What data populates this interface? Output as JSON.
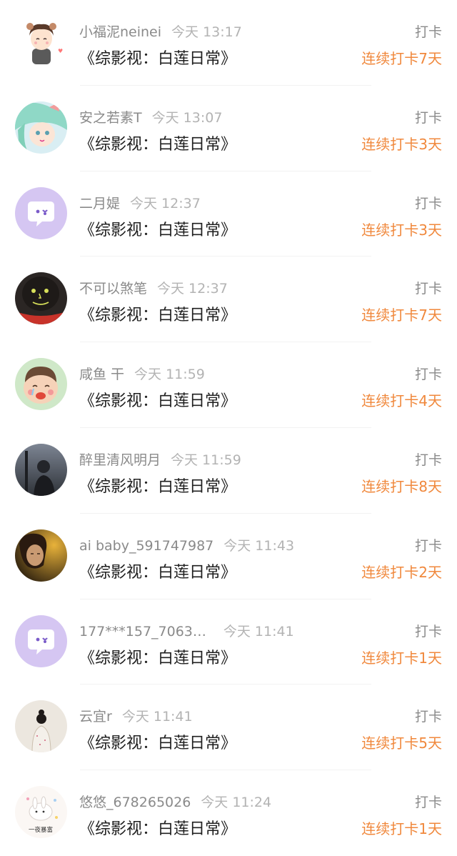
{
  "entries": [
    {
      "username": "小福泥neinei",
      "time": "今天 13:17",
      "book": "《综影视：白莲日常》",
      "action": "打卡",
      "streak": "连续打卡7天",
      "avatar": "cartoon-boy-avatar"
    },
    {
      "username": "安之若素T",
      "time": "今天 13:07",
      "book": "《综影视：白莲日常》",
      "action": "打卡",
      "streak": "连续打卡3天",
      "avatar": "anime-girl-avatar"
    },
    {
      "username": "二月媞",
      "time": "今天 12:37",
      "book": "《综影视：白莲日常》",
      "action": "打卡",
      "streak": "连续打卡3天",
      "avatar": "default-chat-avatar"
    },
    {
      "username": "不可以煞笔",
      "time": "今天 12:37",
      "book": "《综影视：白莲日常》",
      "action": "打卡",
      "streak": "连续打卡7天",
      "avatar": "dark-face-avatar"
    },
    {
      "username": "咸鱼 干",
      "time": "今天 11:59",
      "book": "《综影视：白莲日常》",
      "action": "打卡",
      "streak": "连续打卡4天",
      "avatar": "cartoon-crying-avatar"
    },
    {
      "username": "醉里清风明月",
      "time": "今天 11:59",
      "book": "《综影视：白莲日常》",
      "action": "打卡",
      "streak": "连续打卡8天",
      "avatar": "photo-dark-avatar"
    },
    {
      "username": "ai baby_591747987",
      "time": "今天 11:43",
      "book": "《综影视：白莲日常》",
      "action": "打卡",
      "streak": "连续打卡2天",
      "avatar": "photo-face-avatar"
    },
    {
      "username": "177***157_7063…",
      "time": "今天 11:41",
      "book": "《综影视：白莲日常》",
      "action": "打卡",
      "streak": "连续打卡1天",
      "avatar": "default-chat-avatar"
    },
    {
      "username": "云宜r",
      "time": "今天 11:41",
      "book": "《综影视：白莲日常》",
      "action": "打卡",
      "streak": "连续打卡5天",
      "avatar": "girl-silhouette-avatar"
    },
    {
      "username": "悠悠_678265026",
      "time": "今天 11:24",
      "book": "《综影视：白莲日常》",
      "action": "打卡",
      "streak": "连续打卡1天",
      "avatar": "rabbit-avatar"
    }
  ],
  "avatar_caption": "一夜暴富",
  "colors": {
    "streak": "#f0883c",
    "username": "#8a8a8a",
    "time": "#b3b3b3",
    "default_avatar": "#d5c6f2"
  }
}
